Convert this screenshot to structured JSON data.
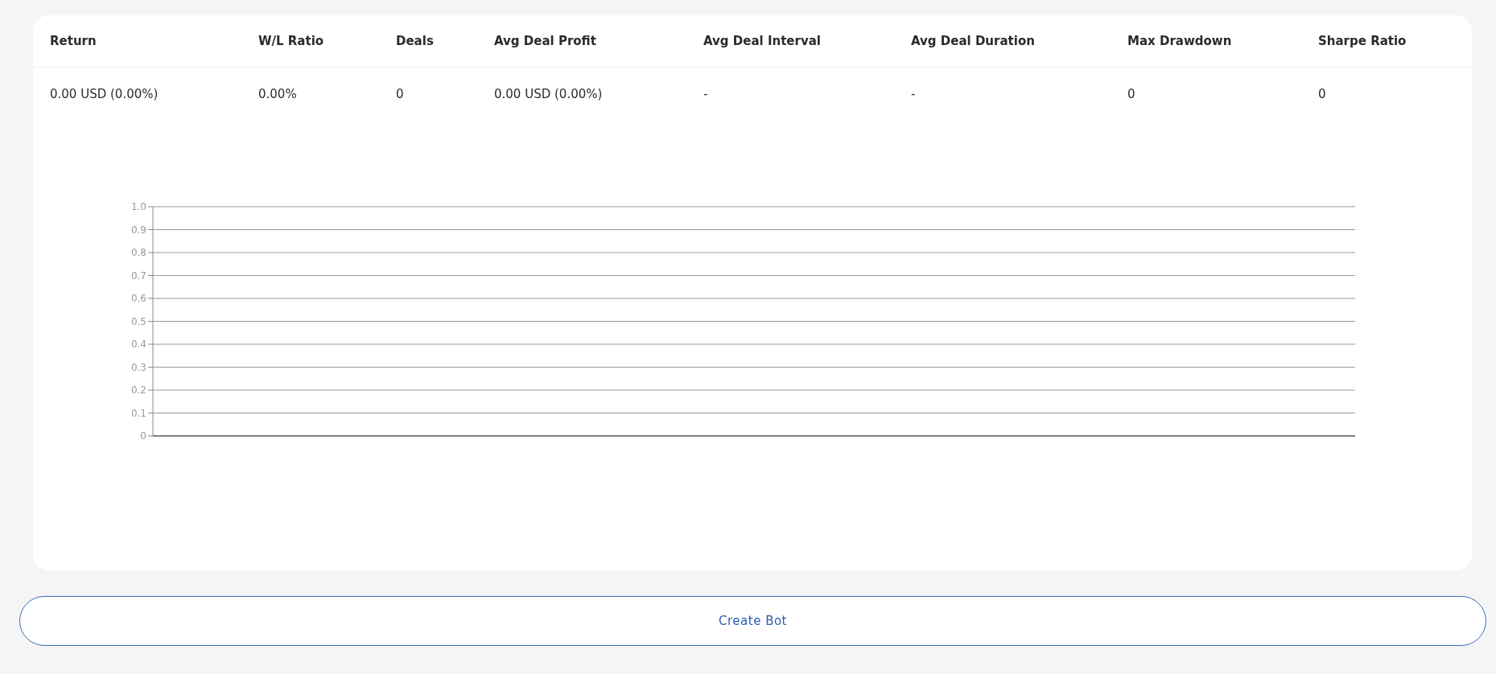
{
  "stats_table": {
    "columns": [
      "Return",
      "W/L Ratio",
      "Deals",
      "Avg Deal Profit",
      "Avg Deal Interval",
      "Avg Deal Duration",
      "Max Drawdown",
      "Sharpe Ratio"
    ],
    "rows": [
      [
        "0.00 USD (0.00%)",
        "0.00%",
        "0",
        "0.00 USD (0.00%)",
        "-",
        "-",
        "0",
        "0"
      ]
    ]
  },
  "chart": {
    "y_axis_labels": [
      "1.0",
      "0.9",
      "0.8",
      "0.7",
      "0.6",
      "0.5",
      "0.4",
      "0.3",
      "0.2",
      "0.1",
      "0"
    ]
  },
  "create_button": {
    "label": "Create Bot"
  }
}
